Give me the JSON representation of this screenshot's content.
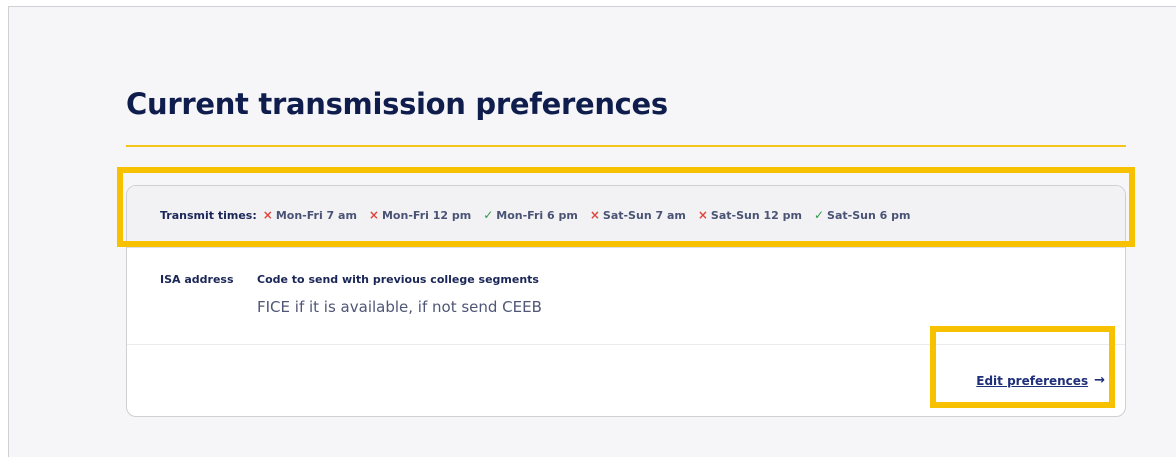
{
  "page": {
    "title": "Current transmission preferences"
  },
  "transmit": {
    "label": "Transmit times:",
    "slots": [
      {
        "label": "Mon-Fri 7 am",
        "enabled": false,
        "icon": "x-icon"
      },
      {
        "label": "Mon-Fri 12 pm",
        "enabled": false,
        "icon": "x-icon"
      },
      {
        "label": "Mon-Fri 6 pm",
        "enabled": true,
        "icon": "check-icon"
      },
      {
        "label": "Sat-Sun 7 am",
        "enabled": false,
        "icon": "x-icon"
      },
      {
        "label": "Sat-Sun 12 pm",
        "enabled": false,
        "icon": "x-icon"
      },
      {
        "label": "Sat-Sun 6 pm",
        "enabled": true,
        "icon": "check-icon"
      }
    ],
    "off_symbol": "×",
    "on_symbol": "✓"
  },
  "details": {
    "isa_label": "ISA address",
    "code_label": "Code to send with previous college segments",
    "code_value": "FICE if it is available, if not send CEEB"
  },
  "actions": {
    "edit_label": "Edit preferences",
    "edit_arrow": "→"
  },
  "colors": {
    "title": "#0f1d4d",
    "accent_rule": "#f5c518",
    "highlight": "#f7c100",
    "off": "#e0453c",
    "on": "#2e9a4a",
    "link": "#1f2f7a"
  }
}
